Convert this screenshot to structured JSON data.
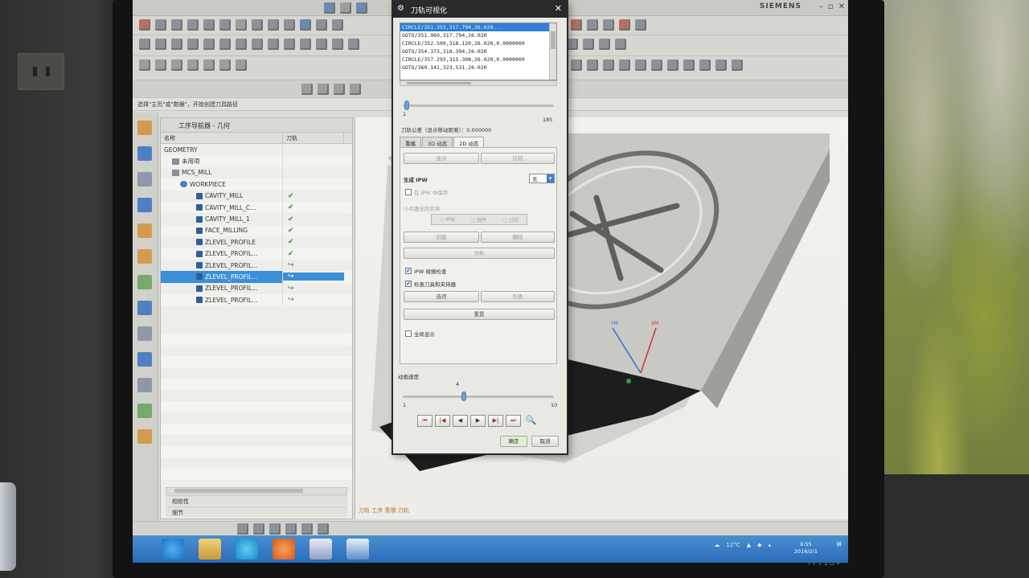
{
  "window": {
    "vendor": "SIEMENS"
  },
  "hint": "选择\"主页\"或\"数据\"，开始创建刀具路径",
  "navigator": {
    "title": "工序导航器 - 几何",
    "columns": [
      "名称",
      "刀轨"
    ],
    "rows": [
      {
        "name": "GEOMETRY",
        "indent": 0,
        "icon": "geometry",
        "status": ""
      },
      {
        "name": "未用项",
        "indent": 1,
        "icon": "group",
        "status": ""
      },
      {
        "name": "MCS_MILL",
        "indent": 1,
        "icon": "mcs",
        "status": ""
      },
      {
        "name": "WORKPIECE",
        "indent": 2,
        "icon": "workpiece",
        "status": ""
      },
      {
        "name": "CAVITY_MILL",
        "indent": 4,
        "icon": "operation",
        "status": "✔"
      },
      {
        "name": "CAVITY_MILL_C...",
        "indent": 4,
        "icon": "operation",
        "status": "✔"
      },
      {
        "name": "CAVITY_MILL_1",
        "indent": 4,
        "icon": "operation",
        "status": "✔"
      },
      {
        "name": "FACE_MILLING",
        "indent": 4,
        "icon": "operation",
        "status": "✔"
      },
      {
        "name": "ZLEVEL_PROFILE",
        "indent": 4,
        "icon": "operation",
        "status": "✔"
      },
      {
        "name": "ZLEVEL_PROFIL...",
        "indent": 4,
        "icon": "operation",
        "status": "✔"
      },
      {
        "name": "ZLEVEL_PROFIL...",
        "indent": 4,
        "icon": "operation",
        "status": "↪"
      },
      {
        "name": "ZLEVEL_PROFIL...",
        "indent": 4,
        "icon": "operation",
        "status": "↪",
        "selected": true
      },
      {
        "name": "ZLEVEL_PROFIL...",
        "indent": 4,
        "icon": "operation",
        "status": "↪"
      },
      {
        "name": "ZLEVEL_PROFIL...",
        "indent": 4,
        "icon": "operation",
        "status": "↪"
      }
    ],
    "dependencies": "相依性",
    "details": "细节"
  },
  "viewport": {
    "status": "刀轨 工序 重播 刀轨",
    "axes": {
      "x": "XM",
      "y": "YM"
    }
  },
  "dialog": {
    "title": "刀轨可视化",
    "code_lines": [
      "CIRCLE/351.353,317.794,26.020...",
      "GOTO/351.969,317.794,26.020",
      "CIRCLE/352.509,318.120,26.020,0.0000000",
      "GOTO/354.373,318.394,26.020",
      "CIRCLE/357.293,315.308,26.020,0.0000000",
      "GOTO/360.141,323.531,26.020"
    ],
    "motion_min": "1",
    "motion_max": "185",
    "motion_value": 0.01,
    "tolerance_label": "刀轨公差（显示移动距离）：0.000000",
    "tabs": [
      "重播",
      "3D 动态",
      "2D 动态"
    ],
    "active_tab": "2D 动态",
    "buttons_top": [
      "显示",
      "比较"
    ],
    "ipw_label": "生成 IPW",
    "ipw_value": "无",
    "ipw_check": "在 IPW 中保存",
    "small_volume_label": "小平面化的实体",
    "radio": [
      "IPW",
      "制件",
      "过切"
    ],
    "btn_row2": [
      "创建",
      "删除"
    ],
    "btn_analyze": "分析",
    "ipw_collision": "IPW 碰撞检查",
    "check_tool": "检查刀具和夹持器",
    "btn_row3": [
      "选项",
      "列表"
    ],
    "reset": "重置",
    "advance": "全局显示",
    "speed_label": "动画速度",
    "speed_min": "1",
    "speed_max": "10",
    "speed_tick": "4",
    "speed_value": 0.4,
    "ok": "确定",
    "cancel": "取消"
  },
  "taskbar": {
    "weather": "12°C",
    "clock_time": "9:55",
    "clock_date": "2016/2/1",
    "ime": "拼"
  },
  "monitor_brand": "FP71G+"
}
